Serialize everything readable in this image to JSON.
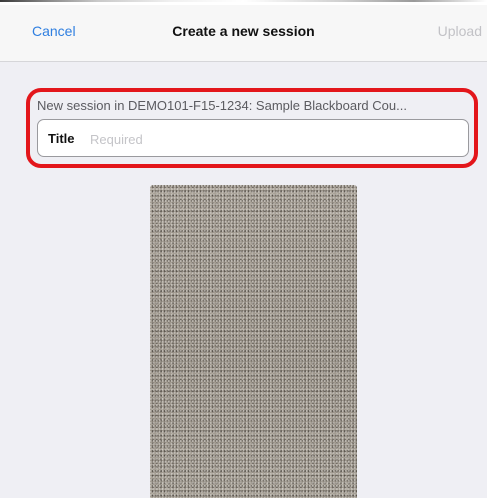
{
  "navbar": {
    "cancel_label": "Cancel",
    "title": "Create a new session",
    "upload_label": "Upload"
  },
  "session": {
    "caption": "New session in DEMO101-F15-1234: Sample Blackboard Cou...",
    "title_field": {
      "label": "Title",
      "value": "",
      "placeholder": "Required"
    }
  },
  "colors": {
    "accent": "#2f7fe0",
    "disabled": "#c2c2c6",
    "highlight": "#e3161b",
    "background": "#efeff4"
  }
}
